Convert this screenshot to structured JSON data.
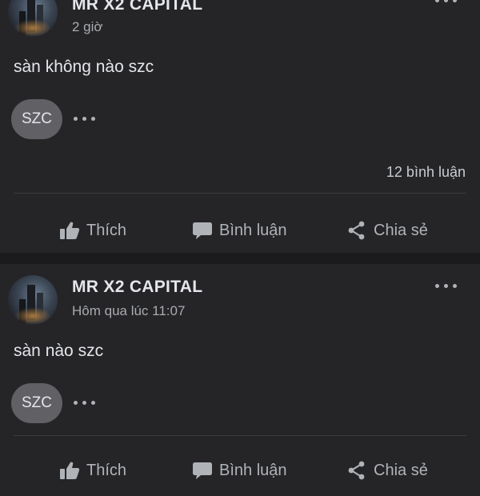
{
  "posts": [
    {
      "author": "MR X2 CAPITAL",
      "time": "2 giờ",
      "text": "sàn không nào szc",
      "tag": "SZC",
      "comments": "12 bình luận",
      "actions": {
        "like": "Thích",
        "comment": "Bình luận",
        "share": "Chia sẻ"
      }
    },
    {
      "author": "MR X2 CAPITAL",
      "time": "Hôm qua lúc 11:07",
      "text": "sàn nào szc",
      "tag": "SZC",
      "actions": {
        "like": "Thích",
        "comment": "Bình luận",
        "share": "Chia sẻ"
      }
    }
  ],
  "colors": {
    "background": "#1b1b1d",
    "card": "#252527",
    "pill": "#606065",
    "text": "#e4e6eb",
    "muted": "#b0b3b8"
  }
}
